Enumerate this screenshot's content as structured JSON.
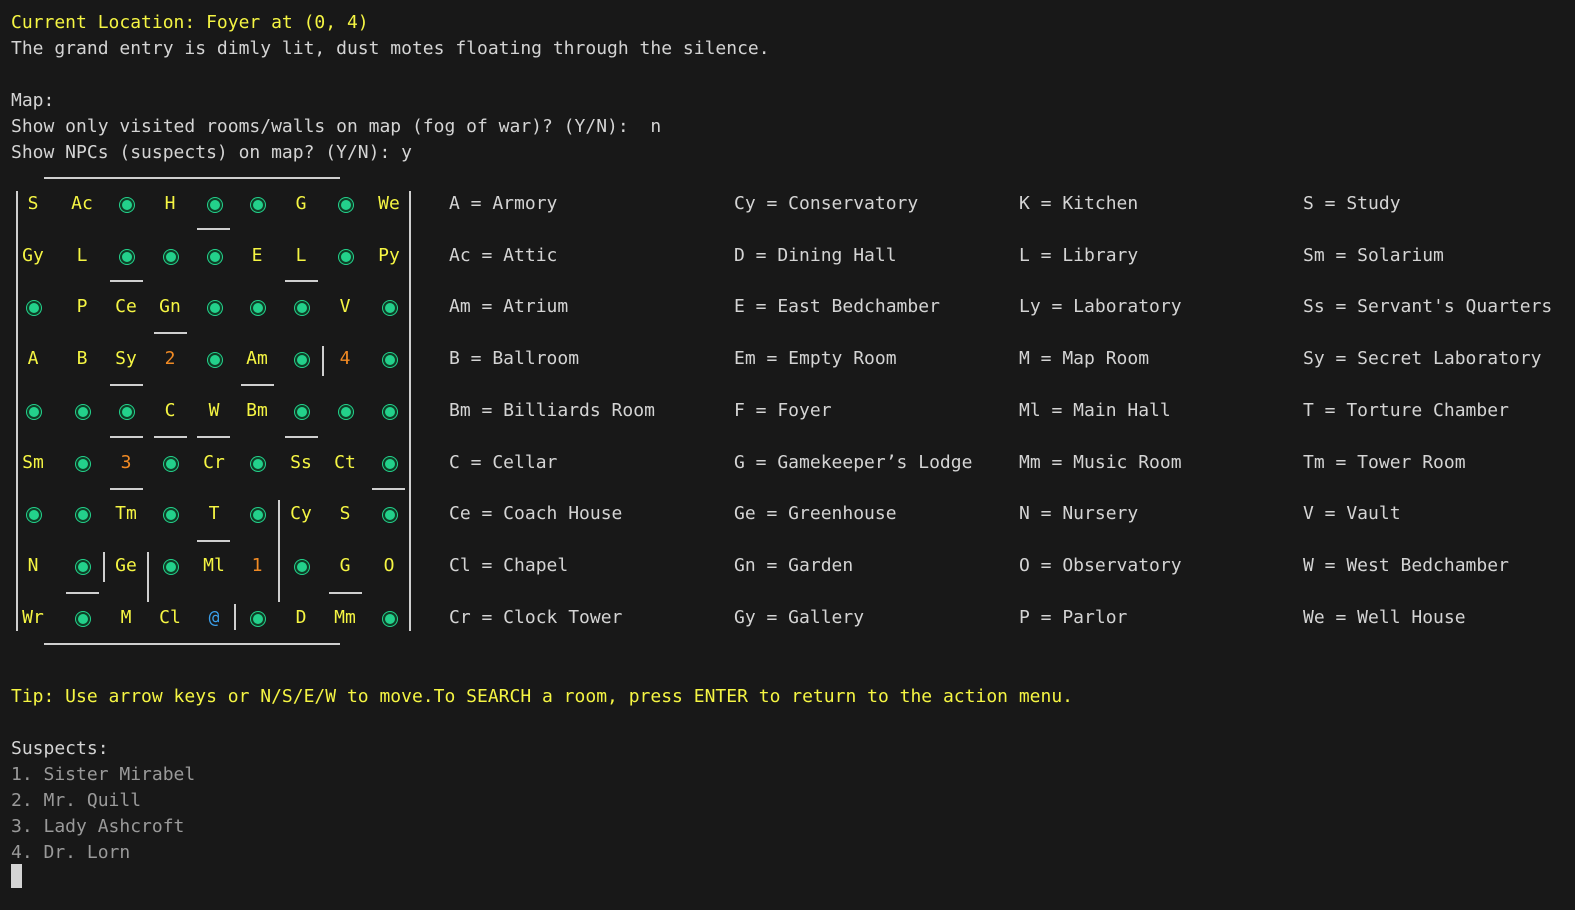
{
  "header": {
    "location": "Current Location: Foyer at (0, 4)",
    "description": "The grand entry is dimly lit, dust motes floating through the silence."
  },
  "prompts": {
    "map_label": "Map:",
    "fog_prompt": "Show only visited rooms/walls on map (fog of war)? (Y/N):  n",
    "npc_prompt": "Show NPCs (suspects) on map? (Y/N): y"
  },
  "map": {
    "rows": [
      [
        "S",
        "Ac",
        "●",
        "H",
        "●",
        "●",
        "G",
        "●",
        "We"
      ],
      [
        "Gy",
        "L",
        "●",
        "●",
        "●",
        "E",
        "L",
        "●",
        "Py"
      ],
      [
        "●",
        "P",
        "Ce",
        "Gn",
        "●",
        "●",
        "●",
        "V",
        "●"
      ],
      [
        "A",
        "B",
        "Sy",
        "2",
        "●",
        "Am",
        "●",
        "4",
        "●"
      ],
      [
        "●",
        "●",
        "●",
        "C",
        "W",
        "Bm",
        "●",
        "●",
        "●"
      ],
      [
        "Sm",
        "●",
        "3",
        "●",
        "Cr",
        "●",
        "Ss",
        "Ct",
        "●"
      ],
      [
        "●",
        "●",
        "Tm",
        "●",
        "T",
        "●",
        "Cy",
        "S",
        "●"
      ],
      [
        "N",
        "●",
        "Ge",
        "●",
        "Ml",
        "1",
        "●",
        "G",
        "O"
      ],
      [
        "Wr",
        "●",
        "M",
        "Cl",
        "@",
        "●",
        "D",
        "Mm",
        "●"
      ]
    ],
    "markers": {
      "npc": "●",
      "player": "@"
    }
  },
  "legend": {
    "col1": [
      "A = Armory",
      "Ac = Attic",
      "Am = Atrium",
      "B = Ballroom",
      "Bm = Billiards Room",
      "C = Cellar",
      "Ce = Coach House",
      "Cl = Chapel",
      "Cr = Clock Tower"
    ],
    "col2": [
      "Cy = Conservatory",
      "D = Dining Hall",
      "E = East Bedchamber",
      "Em = Empty Room",
      "F = Foyer",
      "G = Gamekeeper’s Lodge",
      "Ge = Greenhouse",
      "Gn = Garden",
      "Gy = Gallery"
    ],
    "col3": [
      "K = Kitchen",
      "L = Library",
      "Ly = Laboratory",
      "M = Map Room",
      "Ml = Main Hall",
      "Mm = Music Room",
      "N = Nursery",
      "O = Observatory",
      "P = Parlor"
    ],
    "col4": [
      "S = Study",
      "Sm = Solarium",
      "Ss = Servant's Quarters",
      "Sy = Secret Laboratory",
      "T = Torture Chamber",
      "Tm = Tower Room",
      "V = Vault",
      "W = West Bedchamber",
      "We = Well House"
    ]
  },
  "tip": "Tip: Use arrow keys or N/S/E/W to move.To SEARCH a room, press ENTER to return to the action menu.",
  "suspects": {
    "title": "Suspects:",
    "items": [
      "1. Sister Mirabel",
      "2. Mr. Quill",
      "3. Lady Ashcroft",
      "4. Dr. Lorn"
    ]
  },
  "colors": {
    "background": "#181818",
    "text": "#d4d4d4",
    "room": "#f5f543",
    "number": "#f08a24",
    "npc": "#23d18b",
    "player": "#3b9ee8",
    "suspect": "#9a9a9a"
  }
}
